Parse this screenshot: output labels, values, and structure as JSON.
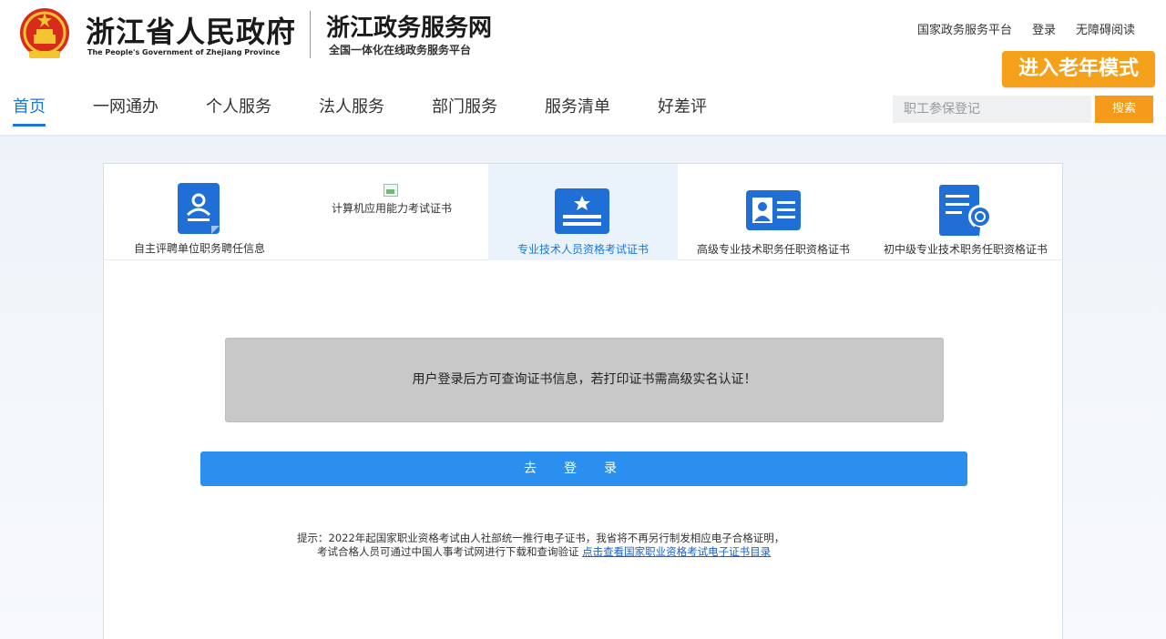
{
  "header": {
    "site_title": "浙江省人民政府",
    "site_title_en": "The People's Government of Zhejiang Province",
    "portal_title": "浙江政务服务网",
    "portal_subtitle": "全国一体化在线政务服务平台",
    "top_links": [
      "国家政务服务平台",
      "登录",
      "无障碍阅读"
    ],
    "elder_mode_label": "进入老年模式",
    "nav": [
      "首页",
      "一网通办",
      "个人服务",
      "法人服务",
      "部门服务",
      "服务清单",
      "好差评"
    ],
    "search_placeholder": "职工参保登记",
    "search_button": "搜索"
  },
  "tabs": [
    {
      "label": "自主评聘单位职务聘任信息",
      "icon": "person-document-icon"
    },
    {
      "label": "计算机应用能力考试证书",
      "icon": "broken-image-icon"
    },
    {
      "label": "专业技术人员资格考试证书",
      "icon": "star-certificate-icon",
      "active": true
    },
    {
      "label": "高级专业技术职务任职资格证书",
      "icon": "id-card-icon"
    },
    {
      "label": "初中级专业技术职务任职资格证书",
      "icon": "certificate-badge-icon"
    }
  ],
  "notice_text": "用户登录后方可查询证书信息，若打印证书需高级实名认证！",
  "login_button": "去登录",
  "tip": {
    "line1": "提示：2022年起国家职业资格考试由人社部统一推行电子证书，我省将不再另行制发相应电子合格证明，",
    "line2_prefix": "考试合格人员可通过中国人事考试网进行下载和查询验证",
    "link_text": "点击查看国家职业资格考试电子证书目录"
  },
  "colors": {
    "accent_blue": "#1a78d8",
    "button_blue": "#2b8ff0",
    "orange": "#f5a01a"
  }
}
